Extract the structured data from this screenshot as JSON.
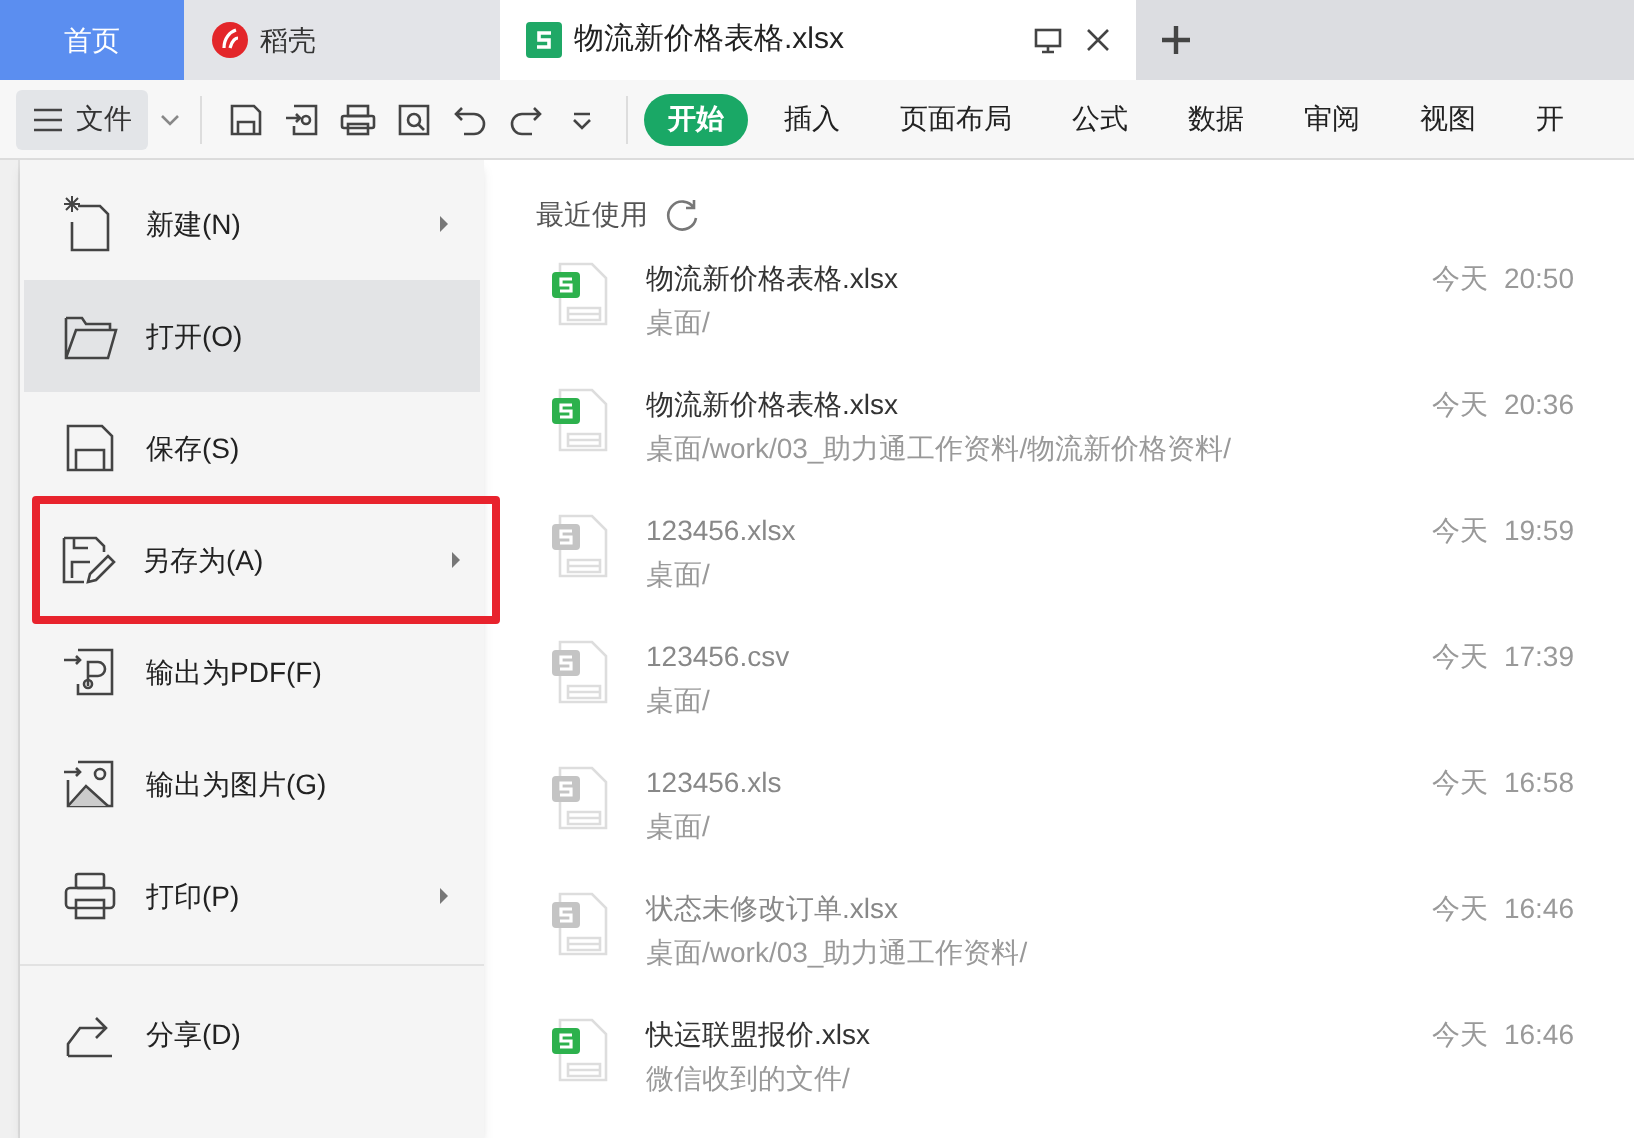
{
  "tabs": [
    {
      "kind": "home",
      "label": "首页",
      "selected": false
    },
    {
      "kind": "docer",
      "label": "稻壳",
      "selected": false
    },
    {
      "kind": "file",
      "label": "物流新价格表格.xlsx",
      "selected": true
    }
  ],
  "toolbar": {
    "file_menu": "文件",
    "ribbon_tabs": [
      {
        "label": "开始",
        "selected": true
      },
      {
        "label": "插入",
        "selected": false
      },
      {
        "label": "页面布局",
        "selected": false
      },
      {
        "label": "公式",
        "selected": false
      },
      {
        "label": "数据",
        "selected": false
      },
      {
        "label": "审阅",
        "selected": false
      },
      {
        "label": "视图",
        "selected": false
      },
      {
        "label": "开",
        "selected": false
      }
    ]
  },
  "file_menu": {
    "items": [
      {
        "kind": "new",
        "label": "新建(N)",
        "submenu": true,
        "selected": false,
        "annotated": false
      },
      {
        "kind": "open",
        "label": "打开(O)",
        "submenu": false,
        "selected": true,
        "annotated": false
      },
      {
        "kind": "save",
        "label": "保存(S)",
        "submenu": false,
        "selected": false,
        "annotated": false
      },
      {
        "kind": "saveas",
        "label": "另存为(A)",
        "submenu": true,
        "selected": false,
        "annotated": true
      },
      {
        "kind": "pdf",
        "label": "输出为PDF(F)",
        "submenu": false,
        "selected": false,
        "annotated": false
      },
      {
        "kind": "image",
        "label": "输出为图片(G)",
        "submenu": false,
        "selected": false,
        "annotated": false
      },
      {
        "kind": "print",
        "label": "打印(P)",
        "submenu": true,
        "selected": false,
        "annotated": false
      },
      {
        "kind": "share",
        "label": "分享(D)",
        "submenu": false,
        "selected": false,
        "annotated": false
      }
    ]
  },
  "recent": {
    "title": "最近使用",
    "files": [
      {
        "name": "物流新价格表格.xlsx",
        "path": "桌面/",
        "time": "今天  20:50",
        "available": true
      },
      {
        "name": "物流新价格表格.xlsx",
        "path": "桌面/work/03_助力通工作资料/物流新价格资料/",
        "time": "今天  20:36",
        "available": true
      },
      {
        "name": "123456.xlsx",
        "path": "桌面/",
        "time": "今天  19:59",
        "available": false
      },
      {
        "name": "123456.csv",
        "path": "桌面/",
        "time": "今天  17:39",
        "available": false
      },
      {
        "name": "123456.xls",
        "path": "桌面/",
        "time": "今天  16:58",
        "available": false
      },
      {
        "name": "状态未修改订单.xlsx",
        "path": "桌面/work/03_助力通工作资料/",
        "time": "今天  16:46",
        "available": false
      },
      {
        "name": "快运联盟报价.xlsx",
        "path": "微信收到的文件/",
        "time": "今天  16:46",
        "available": true
      }
    ]
  }
}
